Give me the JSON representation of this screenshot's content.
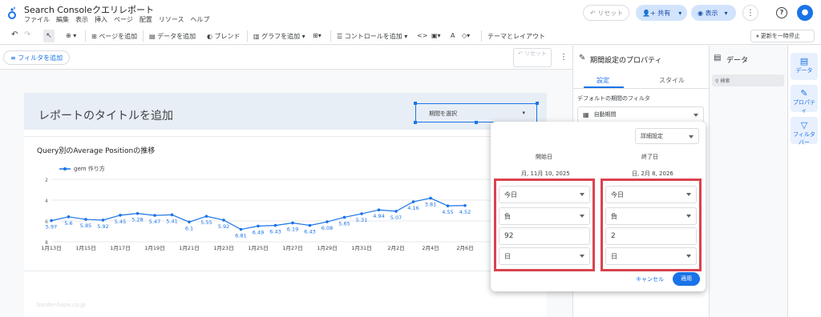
{
  "app": {
    "title": "Search Consoleクエリレポート",
    "menus": [
      "ファイル",
      "編集",
      "表示",
      "挿入",
      "ページ",
      "配置",
      "リソース",
      "ヘルプ"
    ],
    "reset_label": "リセット",
    "share_label": "共有",
    "view_label": "表示"
  },
  "toolbar": {
    "add_page": "ページを追加",
    "add_data": "データを追加",
    "blend": "ブレンド",
    "add_chart": "グラフを追加",
    "add_control": "コントロールを追加",
    "theme": "テーマとレイアウト",
    "pause_update": "更新を一時停止"
  },
  "filterbar": {
    "add_filter": "フィルタを追加",
    "reset": "リセット"
  },
  "report": {
    "title": "レポートのタイトルを追加",
    "date_picker": "期間を選択",
    "watermark": "border-haze.co.jp"
  },
  "chart_data": {
    "type": "line",
    "title": "Query別のAverage Positionの推移",
    "series": [
      {
        "name": "gem 作り方",
        "values": [
          5.97,
          5.6,
          5.85,
          5.92,
          5.45,
          5.28,
          5.47,
          5.41,
          6.1,
          5.55,
          5.92,
          6.81,
          6.49,
          6.43,
          6.19,
          6.43,
          6.08,
          5.65,
          5.31,
          4.94,
          5.07,
          4.16,
          3.81,
          4.55,
          4.52
        ]
      }
    ],
    "x_ticks": [
      "1月13日",
      "1月15日",
      "1月17日",
      "1月19日",
      "1月21日",
      "1月23日",
      "1月25日",
      "1月27日",
      "1月29日",
      "1月31日",
      "2月2日",
      "2月4日",
      "2月6日"
    ],
    "y_ticks": [
      "2",
      "4",
      "6",
      "8"
    ],
    "ylim": [
      8,
      0
    ],
    "color": "#1a73e8"
  },
  "properties": {
    "title": "期間設定のプロパティ",
    "tabs": [
      "設定",
      "スタイル"
    ],
    "default_filter_label": "デフォルトの期間のフィルタ",
    "auto_period": "自動期間"
  },
  "data_panel": {
    "title": "データ",
    "search_placeholder": "検索"
  },
  "rail": {
    "data": "データ",
    "property": "プロパティ",
    "filter": "フィルタバー"
  },
  "popup": {
    "advanced": "詳細設定",
    "start_label": "開始日",
    "end_label": "終了日",
    "start_date": "月, 11月 10, 2025",
    "end_date": "日, 2月 8, 2026",
    "start": {
      "base": "今日",
      "sign": "負",
      "amount": "92",
      "unit": "日"
    },
    "end": {
      "base": "今日",
      "sign": "負",
      "amount": "2",
      "unit": "日"
    },
    "cancel": "キャンセル",
    "apply": "適用"
  }
}
